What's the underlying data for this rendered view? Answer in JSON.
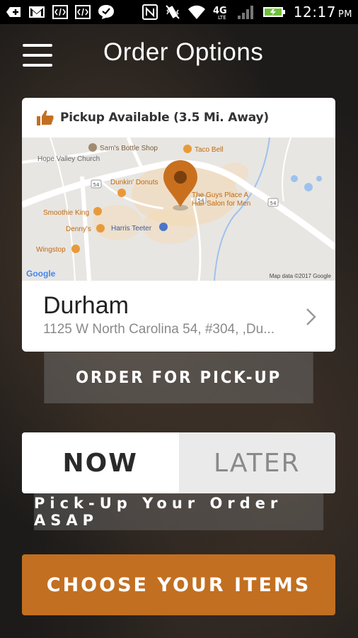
{
  "status_bar": {
    "time": "12:17",
    "ampm": "PM",
    "network": "4G",
    "icons": [
      "add-icon",
      "gmail-icon",
      "code-icon",
      "code-icon",
      "chat-icon",
      "nfc-icon",
      "vibrate-icon",
      "wifi-icon",
      "lte-icon",
      "signal-icon",
      "battery-icon"
    ]
  },
  "header": {
    "title": "Order Options"
  },
  "location_card": {
    "pickup_status": "Pickup Available (3.5 Mi. Away)",
    "city": "Durham",
    "address": "1125 W North Carolina 54, #304, ,Du...",
    "map": {
      "labels": {
        "sams": "Sam's Bottle Shop",
        "taco": "Taco Bell",
        "church": "Hope Valley Church",
        "dunkin": "Dunkin' Donuts",
        "guys1": "The Guys Place A",
        "guys2": "Hair Salon for Men",
        "smoothie": "Smoothie King",
        "dennys": "Denny's",
        "harris": "Harris Teeter",
        "wingstop": "Wingstop",
        "google": "Google",
        "mapdata": "Map data ©2017 Google",
        "road54a": "54",
        "road54b": "54",
        "road54c": "54"
      }
    }
  },
  "order_for_pickup_label": "ORDER FOR PICK-UP",
  "time_toggle": {
    "now": "NOW",
    "later": "LATER",
    "selected": "NOW"
  },
  "asap_text": "Pick-Up Your Order ASAP",
  "cta_label": "CHOOSE YOUR ITEMS",
  "colors": {
    "accent": "#c26f21",
    "map_pin": "#c9701f"
  }
}
